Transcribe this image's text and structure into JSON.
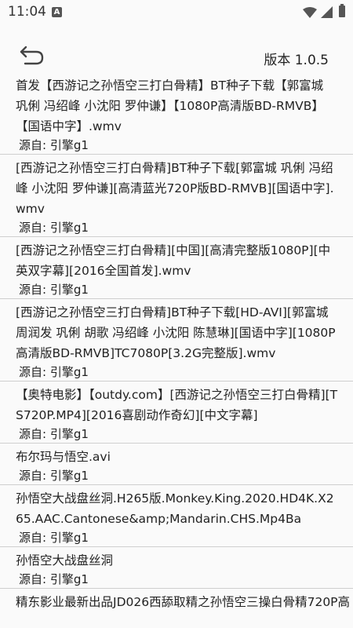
{
  "status": {
    "time": "11:04",
    "notification_letter": "A"
  },
  "header": {
    "version": "版本 1.0.5"
  },
  "results": [
    {
      "title": "首发【西游记之孙悟空三打白骨精】BT种子下载【郭富城 巩俐 冯绍峰 小沈阳 罗仲谦】【1080P高清版BD-RMVB】【国语中字】.wmv",
      "source": "源自: 引擎g1"
    },
    {
      "title": "[西游记之孙悟空三打白骨精]BT种子下载[郭富城 巩俐 冯绍峰 小沈阳 罗仲谦][高清蓝光720P版BD-RMVB][国语中字].wmv",
      "source": "源自: 引擎g1"
    },
    {
      "title": "[西游记之孙悟空三打白骨精][中国][高清完整版1080P][中英双字幕][2016全国首发].wmv",
      "source": "源自: 引擎g1"
    },
    {
      "title": "[西游记之孙悟空三打白骨精]BT种子下载[HD-AVI][郭富城 周润发 巩俐 胡歌 冯绍峰 小沈阳 陈慧琳][国语中字][1080P高清版BD-RMVB]TC7080P[3.2G完整版].wmv",
      "source": "源自: 引擎g1"
    },
    {
      "title": "【奥特电影】【outdy.com】[西游记之孙悟空三打白骨精][TS720P.MP4][2016喜剧动作奇幻][中文字幕]",
      "source": "源自: 引擎g1"
    },
    {
      "title": "布尔玛与悟空.avi",
      "source": "源自: 引擎g1"
    },
    {
      "title": "孙悟空大战盘丝洞.H265版.Monkey.King.2020.HD4K.X265.AAC.Cantonese&amp;Mandarin.CHS.Mp4Ba",
      "source": "源自: 引擎g1"
    },
    {
      "title": "孙悟空大战盘丝洞",
      "source": "源自: 引擎g1"
    },
    {
      "title": "精东影业最新出品JD026西舔取精之孙悟空三操白骨精720P高",
      "source": ""
    }
  ]
}
